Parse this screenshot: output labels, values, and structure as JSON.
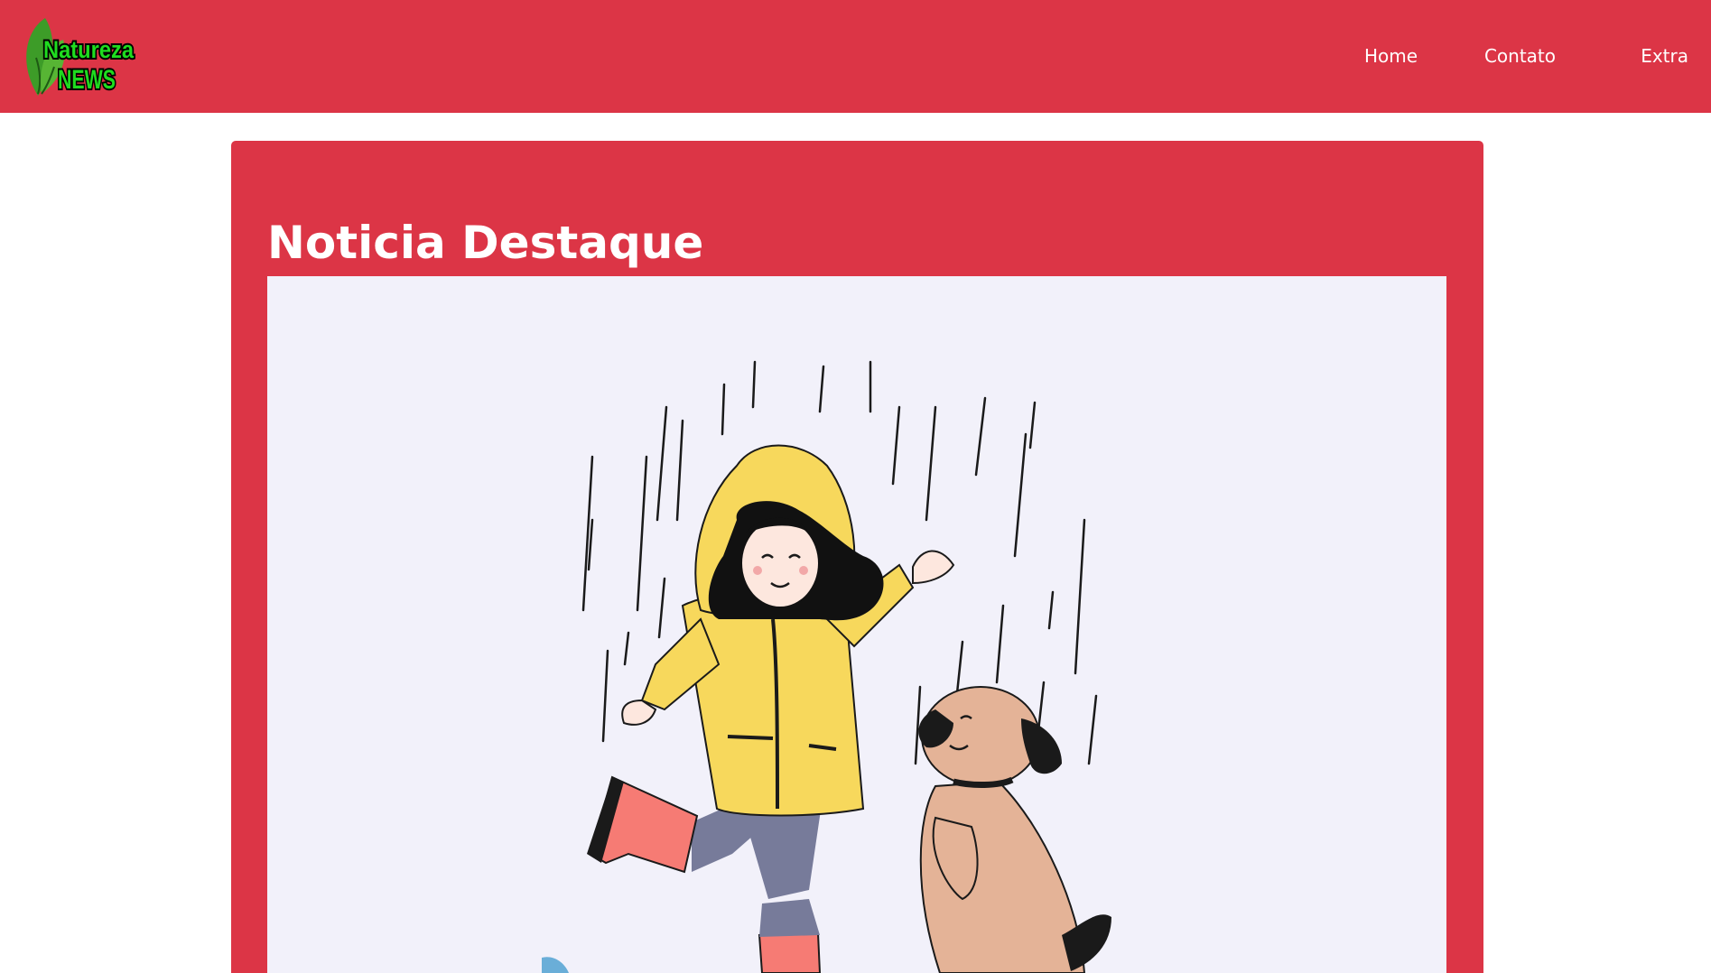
{
  "header": {
    "logo": {
      "line1": "Natureza",
      "line2": "NEWS",
      "icon": "leaf-icon"
    },
    "nav": [
      {
        "label": "Home"
      },
      {
        "label": "Contato"
      },
      {
        "label": "Extra"
      }
    ]
  },
  "featured": {
    "title": "Noticia Destaque",
    "image": "illustration of girl in yellow raincoat playing in the rain with a dog"
  },
  "colors": {
    "brand_red": "#dc3546",
    "image_bg": "#f2f1fa",
    "raincoat_yellow": "#f7d85c",
    "boot_pink": "#f67b74",
    "dog_tan": "#e4b397",
    "pants_gray": "#777b9a",
    "logo_green": "#1fdc1f"
  }
}
